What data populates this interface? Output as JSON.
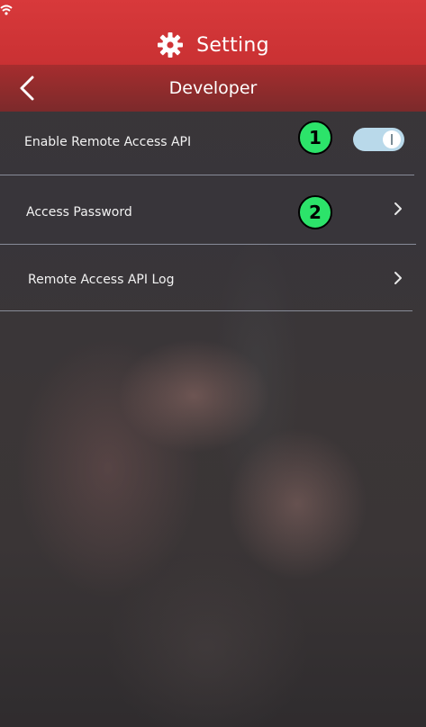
{
  "header": {
    "title": "Setting",
    "icon": "gear-icon"
  },
  "status_bar": {
    "icon": "wifi-icon"
  },
  "sub_header": {
    "title": "Developer",
    "back_icon": "chevron-left-icon"
  },
  "settings": [
    {
      "label": "Enable Remote Access API",
      "control": "toggle",
      "state": "on"
    },
    {
      "label": "Access Password",
      "control": "chevron",
      "icon": "chevron-right-icon"
    },
    {
      "label": "Remote Access API Log",
      "control": "chevron",
      "icon": "chevron-right-icon"
    }
  ],
  "annotations": [
    {
      "number": "1"
    },
    {
      "number": "2"
    }
  ],
  "colors": {
    "header_red": "#d8393b",
    "subheader_red": "#a62d2e",
    "toggle_on": "#b9d9ea",
    "marker_green": "#2ce36a"
  }
}
